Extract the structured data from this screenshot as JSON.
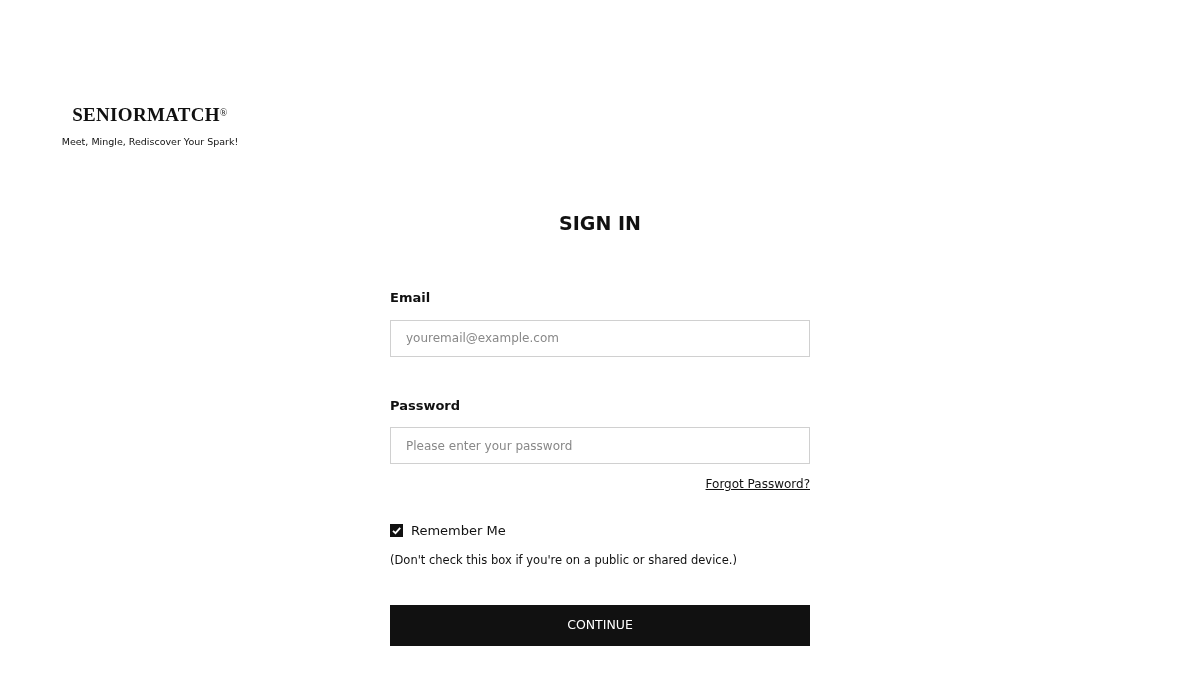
{
  "logo": {
    "name": "SENIORMATCH$^{®}$",
    "tagline": "Meet, Mingle, Rediscover Your Spark!"
  },
  "heading": "SIGN IN",
  "fields": [
    {
      "label": "Email",
      "placeholder": "youremail@example.com"
    },
    {
      "label": "Password",
      "placeholder": "Please enter your password"
    }
  ],
  "forgot_link": "Forgot Password?",
  "remember": {
    "label": "Remember Me",
    "checked": true,
    "note": "(Don't check this box if you're on a public or shared device.)"
  },
  "submit": "CONTINUE"
}
